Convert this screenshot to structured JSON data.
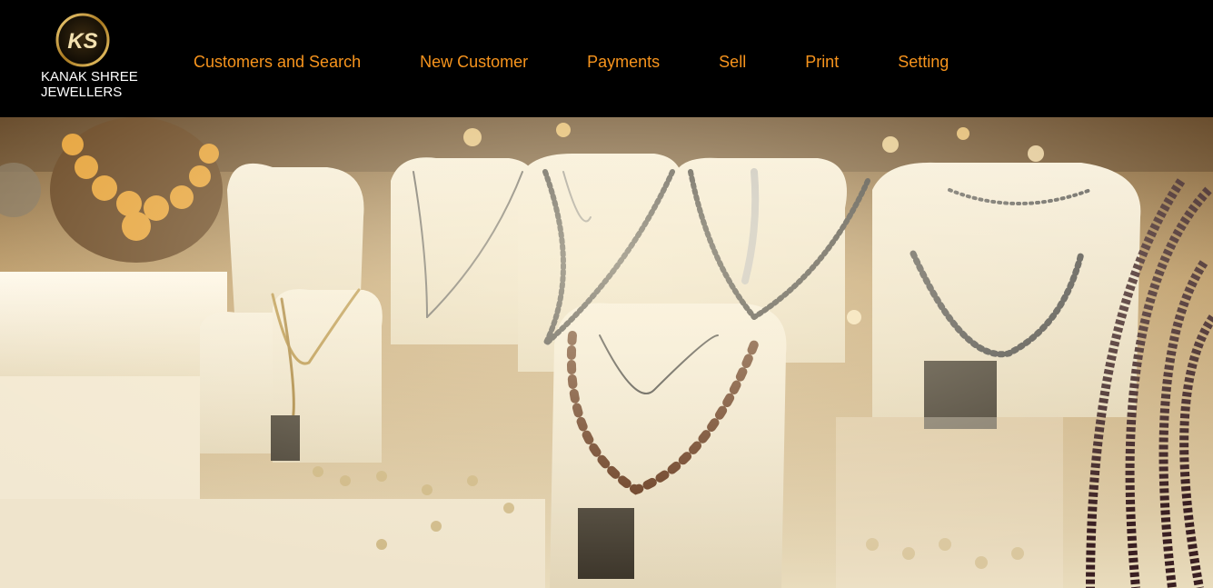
{
  "brand": {
    "logo_text": "KS",
    "name_line1": "KANAK SHREE",
    "name_line2": "JEWELLERS"
  },
  "nav": {
    "items": [
      {
        "label": "Customers and Search"
      },
      {
        "label": "New Customer"
      },
      {
        "label": "Payments"
      },
      {
        "label": "Sell"
      },
      {
        "label": "Print"
      },
      {
        "label": "Setting"
      }
    ]
  },
  "colors": {
    "nav_link": "#f7941d",
    "header_bg": "#000000",
    "logo_gold": "#c9a24a"
  },
  "hero": {
    "icon": "jewellery-showcase-image"
  }
}
